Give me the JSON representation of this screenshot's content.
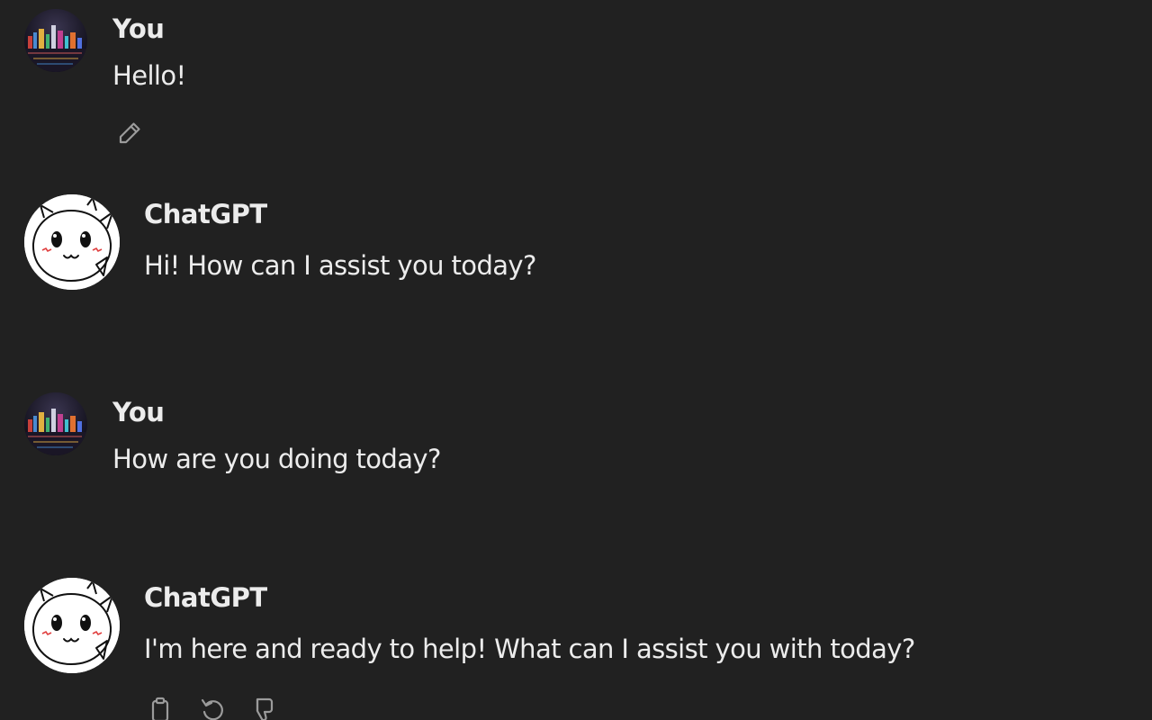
{
  "messages": [
    {
      "author": "You",
      "text": "Hello!"
    },
    {
      "author": "ChatGPT",
      "text": "Hi! How can I assist you today?"
    },
    {
      "author": "You",
      "text": "How are you doing today?"
    },
    {
      "author": "ChatGPT",
      "text": "I'm here and ready to help! What can I assist you with today?"
    }
  ],
  "icons": {
    "edit": "pencil-icon",
    "copy": "clipboard-icon",
    "regenerate": "regenerate-icon",
    "dislike": "thumbs-down-icon"
  },
  "colors": {
    "background": "#212121",
    "text": "#ececec",
    "icon": "#9b9b9b"
  }
}
